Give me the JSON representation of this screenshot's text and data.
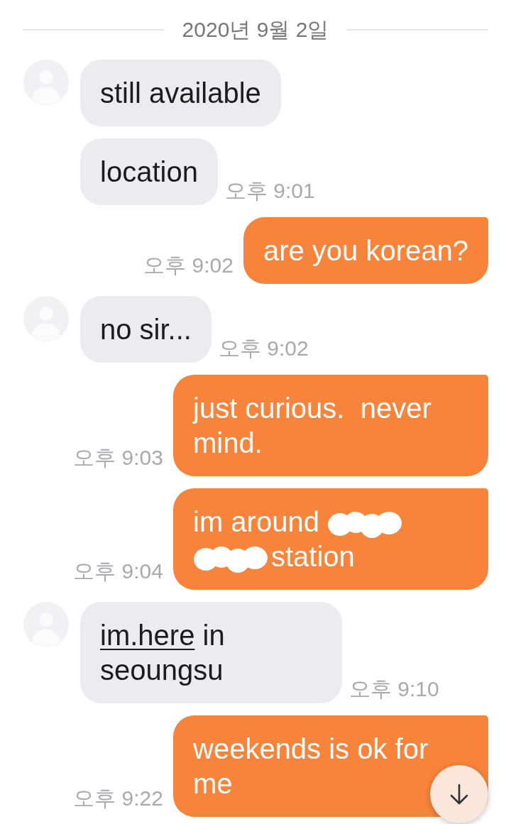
{
  "date_divider": {
    "label": "2020년 9월 2일"
  },
  "messages": [
    {
      "kind": "received",
      "show_avatar": true,
      "text": "still available"
    },
    {
      "kind": "received",
      "show_avatar": false,
      "text": "location",
      "time": "오후 9:01"
    },
    {
      "kind": "sent",
      "text": "are you korean?",
      "time": "오후 9:02"
    },
    {
      "kind": "received",
      "show_avatar": true,
      "text": "no sir...",
      "time": "오후 9:02"
    },
    {
      "kind": "sent",
      "text": "just curious.  never mind.",
      "time": "오후 9:03"
    },
    {
      "kind": "sent",
      "segments": [
        {
          "kind": "text",
          "text": "im around "
        },
        {
          "kind": "redaction"
        },
        {
          "kind": "redaction"
        },
        {
          "kind": "text",
          "text": "station"
        }
      ],
      "time": "오후 9:04"
    },
    {
      "kind": "received",
      "show_avatar": true,
      "segments": [
        {
          "kind": "link",
          "text": "im.here"
        },
        {
          "kind": "text",
          "text": " in seoungsu"
        }
      ],
      "time": "오후 9:10"
    },
    {
      "kind": "sent",
      "text": "weekends is ok for me",
      "time": "오후 9:22"
    }
  ]
}
